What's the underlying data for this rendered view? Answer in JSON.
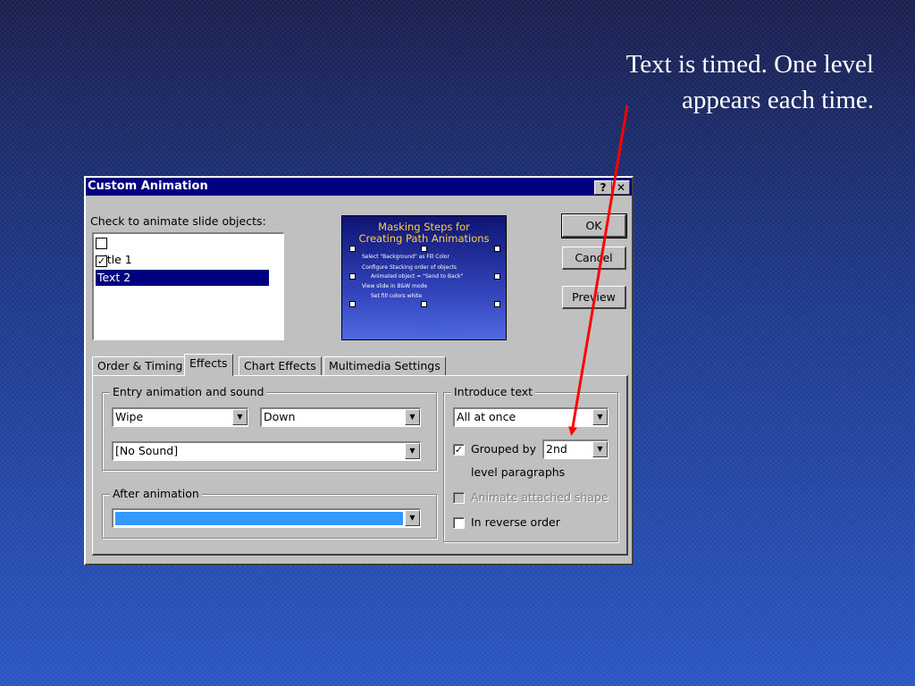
{
  "caption": {
    "line1": "Text is timed.  One level",
    "line2": "appears each time."
  },
  "dialog": {
    "title": "Custom Animation",
    "help_btn": "?",
    "close_btn": "✕",
    "check_label": "Check to animate slide objects:",
    "objects": [
      {
        "label": "Title 1",
        "checked": false,
        "mark": ""
      },
      {
        "label": "Text 2",
        "checked": true,
        "mark": "✓"
      }
    ],
    "preview": {
      "title_line1": "Masking Steps for",
      "title_line2": "Creating Path Animations",
      "lines": [
        "Select \"Background\" as Fill Color",
        "Configure Stacking order of objects",
        "Animated object = \"Send to Back\"",
        "View slide in B&W mode",
        "Set fill colors white"
      ]
    },
    "buttons": {
      "ok": "OK",
      "cancel": "Cancel",
      "preview": "Preview"
    },
    "tabs": [
      "Order & Timing",
      "Effects",
      "Chart Effects",
      "Multimedia Settings"
    ],
    "active_tab": "Effects",
    "entry": {
      "legend": "Entry animation and sound",
      "effect": "Wipe",
      "direction": "Down",
      "sound": "[No Sound]"
    },
    "after": {
      "legend": "After animation"
    },
    "introduce": {
      "legend": "Introduce text",
      "mode": "All at once",
      "grouped_label": "Grouped by",
      "grouped_value": "2nd",
      "grouped_mark": "✓",
      "level_paragraphs": "level paragraphs",
      "animate_attached": "Animate attached shape",
      "reverse_order": "In reverse order"
    },
    "colors": {
      "after_color": "#3399ff"
    }
  }
}
